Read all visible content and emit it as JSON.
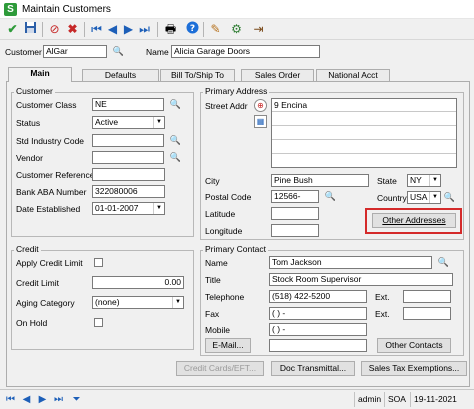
{
  "window": {
    "title": "Maintain Customers",
    "app_icon": "S"
  },
  "toolbar": {
    "icons": [
      "accept-icon",
      "save-icon",
      "delete-icon",
      "cancel-icon",
      "first-record-icon",
      "previous-record-icon",
      "next-record-icon",
      "last-record-icon",
      "print-icon",
      "help-icon",
      "tools-icon",
      "settings-icon",
      "exit-icon"
    ]
  },
  "header": {
    "customer_label": "Customer",
    "customer_value": "AlGar",
    "name_label": "Name",
    "name_value": "Alicia Garage Doors"
  },
  "tabs": [
    {
      "label": "Main",
      "active": true
    },
    {
      "label": "Defaults",
      "active": false
    },
    {
      "label": "Bill To/Ship To",
      "active": false
    },
    {
      "label": "Sales Order",
      "active": false
    },
    {
      "label": "National Acct",
      "active": false
    }
  ],
  "customer_group": {
    "title": "Customer",
    "class_label": "Customer Class",
    "class_value": "NE",
    "status_label": "Status",
    "status_value": "Active",
    "sic_label": "Std Industry Code",
    "sic_value": "",
    "vendor_label": "Vendor",
    "vendor_value": "",
    "reference_label": "Customer Reference",
    "reference_value": "",
    "aba_label": "Bank ABA Number",
    "aba_value": "322080006",
    "established_label": "Date Established",
    "established_value": "01-01-2007"
  },
  "credit_group": {
    "title": "Credit",
    "apply_limit_label": "Apply Credit Limit",
    "limit_label": "Credit Limit",
    "limit_value": "0.00",
    "aging_label": "Aging Category",
    "aging_value": "(none)",
    "on_hold_label": "On Hold"
  },
  "address_group": {
    "title": "Primary Address",
    "street_label": "Street Addr",
    "street_lines": [
      "9 Encina",
      "",
      "",
      "",
      ""
    ],
    "city_label": "City",
    "city_value": "Pine Bush",
    "state_label": "State",
    "state_value": "NY",
    "postal_label": "Postal Code",
    "postal_value": "12566-",
    "country_label": "Country",
    "country_value": "USA",
    "latitude_label": "Latitude",
    "latitude_value": "",
    "longitude_label": "Longitude",
    "longitude_value": "",
    "other_addresses_label": "Other Addresses",
    "highlight_color": "#d42a2a"
  },
  "contact_group": {
    "title": "Primary Contact",
    "name_label": "Name",
    "name_value": "Tom Jackson",
    "title_label": "Title",
    "title_value": "Stock Room Supervisor",
    "telephone_label": "Telephone",
    "telephone_value": "(518) 422-5200",
    "fax_label": "Fax",
    "fax_value": "(   )     -",
    "mobile_label": "Mobile",
    "mobile_value": "(   )     -",
    "ext_label": "Ext.",
    "email_label": "E-Mail...",
    "other_contacts_label": "Other Contacts"
  },
  "bottom_buttons": {
    "credit_cards": "Credit Cards/EFT...",
    "doc_transmittal": "Doc Transmittal...",
    "tax_exemptions": "Sales Tax Exemptions..."
  },
  "statusbar": {
    "icons": [
      "first-icon",
      "previous-icon",
      "next-icon",
      "last-icon",
      "filter-icon"
    ],
    "user": "admin",
    "company": "SOA",
    "date": "19-11-2021"
  }
}
